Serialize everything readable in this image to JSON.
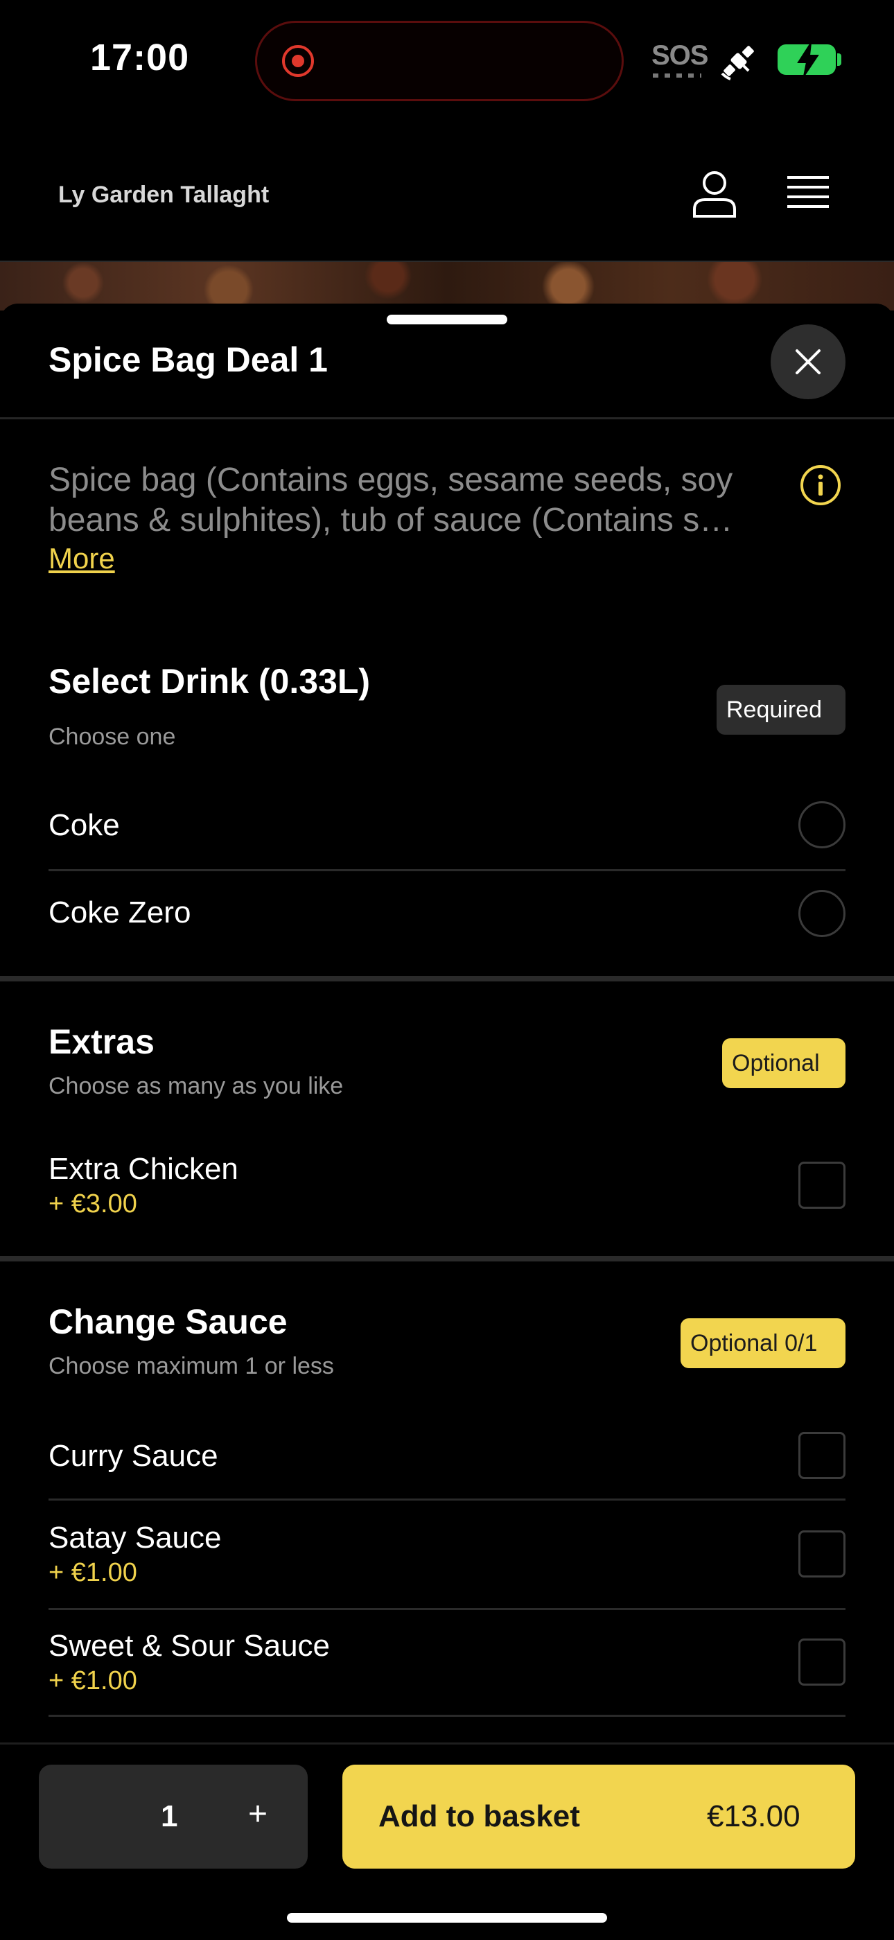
{
  "status_bar": {
    "time": "17:00",
    "sos": "SOS"
  },
  "header": {
    "restaurant": "Ly Garden Tallaght"
  },
  "item": {
    "title": "Spice Bag Deal 1",
    "description": "Spice bag (Contains eggs, sesame seeds, soy beans & sulphites), tub of sauce (Contains s…",
    "more_label": "More"
  },
  "sections": {
    "drink": {
      "title": "Select Drink (0.33L)",
      "subtitle": "Choose one",
      "badge": "Required",
      "options": [
        {
          "label": "Coke"
        },
        {
          "label": "Coke Zero"
        }
      ]
    },
    "extras": {
      "title": "Extras",
      "subtitle": "Choose as many as you like",
      "badge": "Optional",
      "options": [
        {
          "label": "Extra Chicken",
          "price": "+ €3.00"
        }
      ]
    },
    "sauce": {
      "title": "Change Sauce",
      "subtitle": "Choose maximum 1 or less",
      "badge": "Optional 0/1",
      "options": [
        {
          "label": "Curry Sauce"
        },
        {
          "label": "Satay Sauce",
          "price": "+ €1.00"
        },
        {
          "label": "Sweet & Sour Sauce",
          "price": "+ €1.00"
        }
      ]
    }
  },
  "footer": {
    "quantity": "1",
    "plus": "+",
    "add_label": "Add to basket",
    "total": "€13.00"
  },
  "colors": {
    "accent": "#f2d54f",
    "background": "#000000",
    "battery": "#2fd158",
    "record": "#e0382c"
  }
}
